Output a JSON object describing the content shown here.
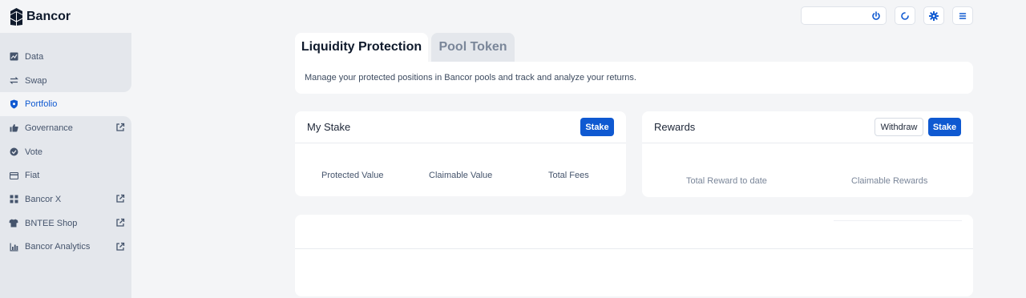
{
  "brand": {
    "name": "Bancor"
  },
  "header": {
    "buttons": [
      {
        "icon": "power-icon"
      },
      {
        "icon": "refresh-icon"
      },
      {
        "icon": "gear-icon"
      },
      {
        "icon": "menu-icon"
      }
    ]
  },
  "sidebar": {
    "items": [
      {
        "label": "Data",
        "icon": "chart-icon",
        "external": false,
        "active": false
      },
      {
        "label": "Swap",
        "icon": "swap-icon",
        "external": false,
        "active": false
      },
      {
        "label": "Portfolio",
        "icon": "shield-icon",
        "external": false,
        "active": true
      },
      {
        "label": "Governance",
        "icon": "thumbs-up-icon",
        "external": true,
        "active": false
      },
      {
        "label": "Vote",
        "icon": "vote-icon",
        "external": false,
        "active": false
      },
      {
        "label": "Fiat",
        "icon": "card-icon",
        "external": false,
        "active": false
      },
      {
        "label": "Bancor X",
        "icon": "grid-icon",
        "external": true,
        "active": false
      },
      {
        "label": "BNTEE Shop",
        "icon": "shirt-icon",
        "external": true,
        "active": false
      },
      {
        "label": "Bancor Analytics",
        "icon": "bar-chart-icon",
        "external": true,
        "active": false
      }
    ]
  },
  "tabs": [
    {
      "label": "Liquidity Protection",
      "active": true
    },
    {
      "label": "Pool Token",
      "active": false
    }
  ],
  "description": "Manage your protected positions in Bancor pools and track and analyze your returns.",
  "my_stake": {
    "title": "My Stake",
    "stake_label": "Stake",
    "metrics": [
      "Protected Value",
      "Claimable Value",
      "Total Fees"
    ]
  },
  "rewards": {
    "title": "Rewards",
    "withdraw_label": "Withdraw",
    "stake_label": "Stake",
    "metrics": [
      "Total Reward to date",
      "Claimable Rewards"
    ]
  },
  "colors": {
    "accent": "#0f59d1",
    "sidebar": "#e4e7ec",
    "background": "#f4f5f7"
  }
}
